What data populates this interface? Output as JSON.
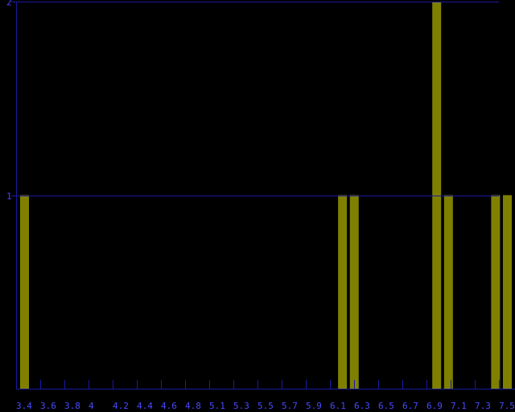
{
  "chart_data": {
    "type": "bar",
    "title": "",
    "xlabel": "",
    "ylabel": "",
    "x_tick_labels": [
      "3.4",
      "3.6",
      "3.8",
      "4",
      "4.2",
      "4.4",
      "4.6",
      "4.8",
      "5.1",
      "5.3",
      "5.5",
      "5.7",
      "5.9",
      "6.1",
      "6.3",
      "6.5",
      "6.7",
      "6.9",
      "7.1",
      "7.3",
      "7.5"
    ],
    "y_tick_labels": [
      "1",
      "2"
    ],
    "ylim": [
      0,
      2
    ],
    "x": [
      3.4,
      6.1,
      6.2,
      6.9,
      7.0,
      7.4,
      7.5
    ],
    "values": [
      1,
      1,
      1,
      2,
      1,
      1,
      1
    ],
    "colors": {
      "bar": "#808000",
      "axis": "#1a1aa0",
      "tick_label": "#4a4aff",
      "background": "#000000"
    },
    "grid": false
  }
}
